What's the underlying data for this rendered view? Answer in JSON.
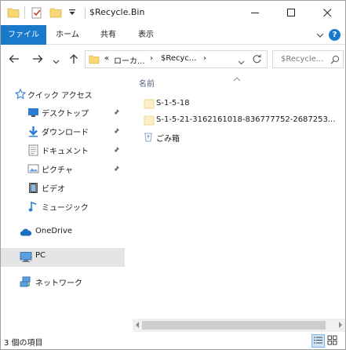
{
  "window": {
    "title": "$Recycle.Bin",
    "accent_color": "#1979ca",
    "quick_access_toolbar": [
      "folder-icon",
      "properties-check-icon",
      "new-folder-icon",
      "customize-dropdown-icon"
    ],
    "controls": [
      "minimize-icon",
      "maximize-icon",
      "close-icon"
    ]
  },
  "ribbon": {
    "tabs": [
      {
        "label": "ファイル"
      },
      {
        "label": "ホーム"
      },
      {
        "label": "共有"
      },
      {
        "label": "表示"
      }
    ],
    "help_label": "?"
  },
  "address": {
    "prefix": "«",
    "crumbs": [
      "ローカ...",
      "$Recyc..."
    ],
    "separator": "›",
    "search_placeholder": "$Recycle...",
    "refresh_icon": "refresh-icon"
  },
  "nav": {
    "items": [
      {
        "label": "クイック アクセス",
        "icon": "quick-access-star-icon",
        "pinned": false
      },
      {
        "label": "デスクトップ",
        "icon": "desktop-icon",
        "pinned": true
      },
      {
        "label": "ダウンロード",
        "icon": "download-arrow-icon",
        "pinned": true
      },
      {
        "label": "ドキュメント",
        "icon": "document-icon",
        "pinned": true
      },
      {
        "label": "ピクチャ",
        "icon": "pictures-icon",
        "pinned": true
      },
      {
        "label": "ビデオ",
        "icon": "video-icon",
        "pinned": false
      },
      {
        "label": "ミュージック",
        "icon": "music-icon",
        "pinned": false
      },
      {
        "label": "OneDrive",
        "icon": "onedrive-cloud-icon",
        "pinned": false
      },
      {
        "label": "PC",
        "icon": "pc-icon",
        "pinned": false,
        "selected": true
      },
      {
        "label": "ネットワーク",
        "icon": "network-icon",
        "pinned": false
      }
    ]
  },
  "content": {
    "column_header": "名前",
    "items": [
      {
        "name": "S-1-5-18",
        "icon": "folder-icon"
      },
      {
        "name": "S-1-5-21-3162161018-836777752-2687253...",
        "icon": "folder-icon"
      },
      {
        "name": "ごみ箱",
        "icon": "recycle-bin-icon"
      }
    ]
  },
  "status": {
    "item_count": "3 個の項目",
    "views": [
      "details-view-icon",
      "large-icons-view-icon"
    ]
  }
}
